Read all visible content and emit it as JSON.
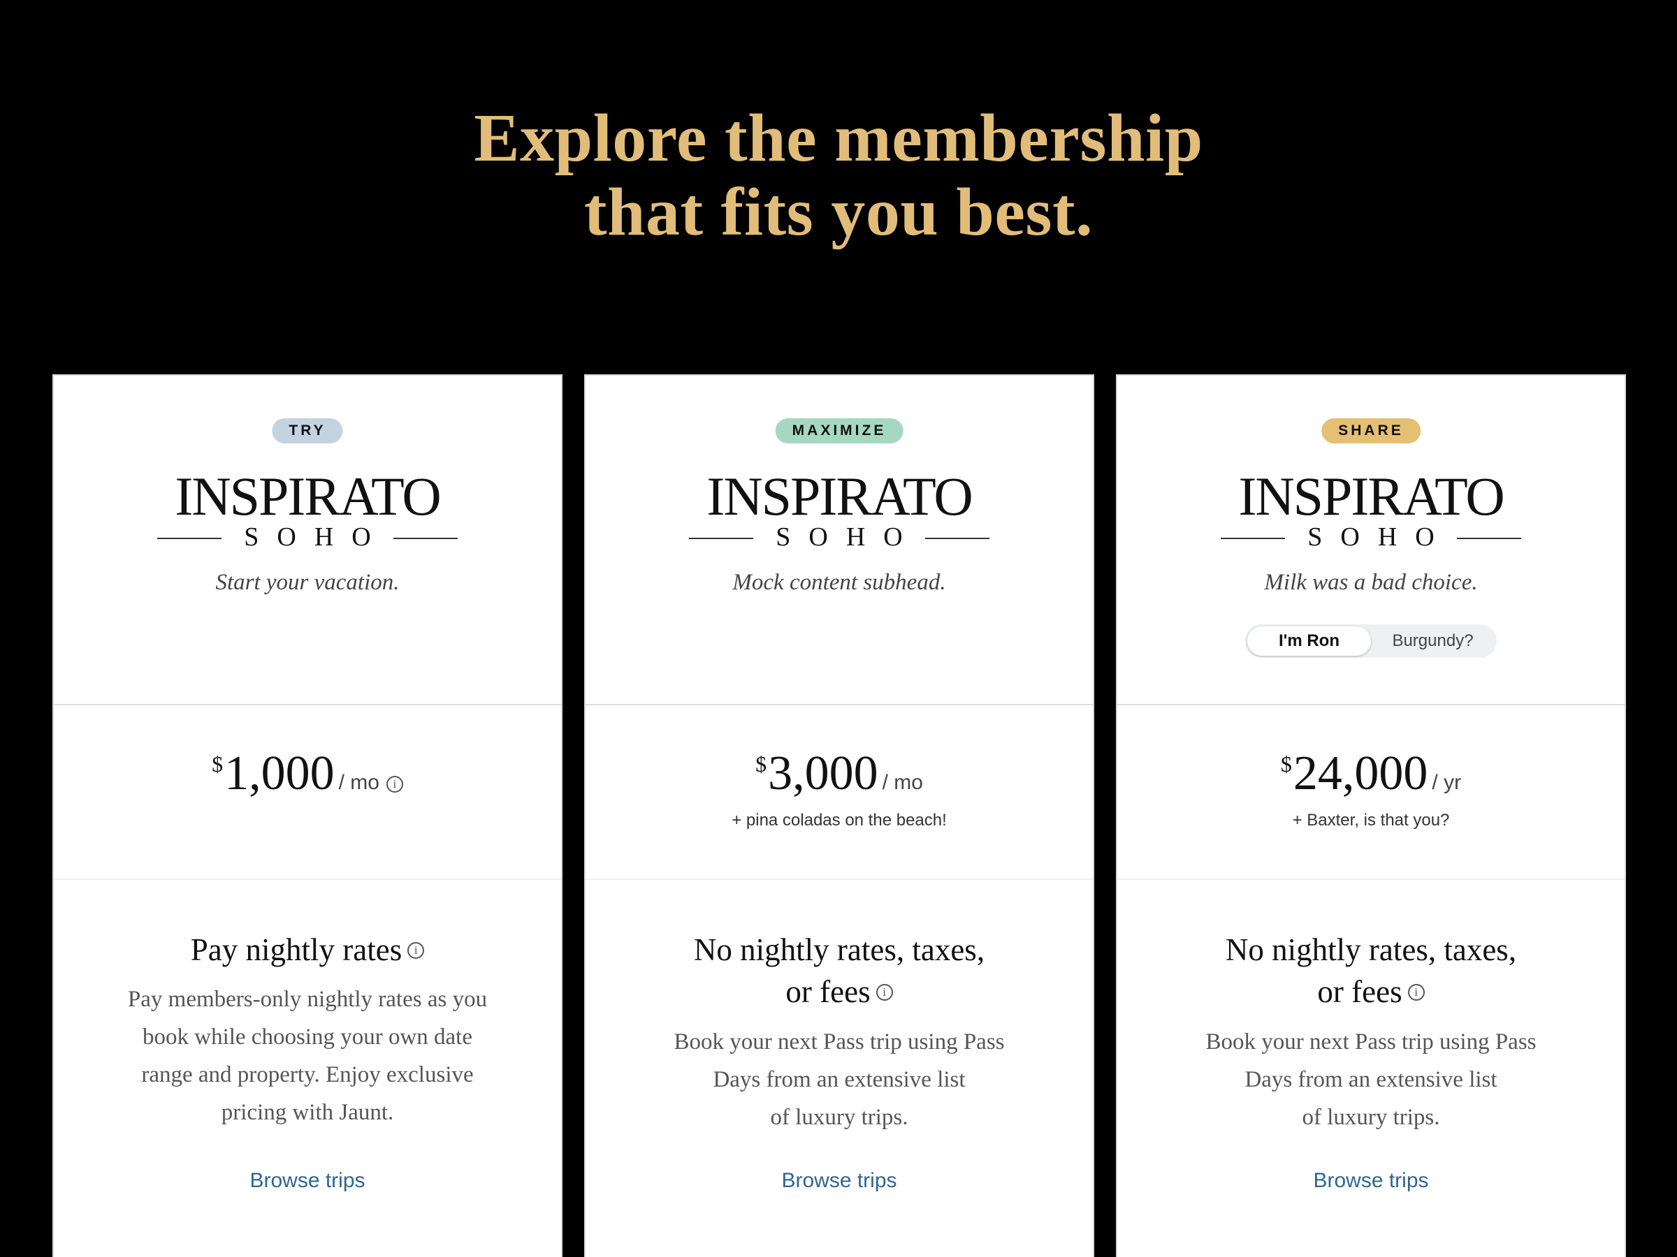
{
  "hero": {
    "line1": "Explore the membership",
    "line2": "that fits you best."
  },
  "colors": {
    "background": "#000000",
    "hero_text": "#e1bd79",
    "badge_try": "#c3d3df",
    "badge_maximize": "#a6d8c1",
    "badge_share": "#e4bf74",
    "link": "#2f6690"
  },
  "logo": {
    "wordmark": "INSPIRATO",
    "sub": "SOHO"
  },
  "cards": [
    {
      "badge": "TRY",
      "subhead": "Start your vacation.",
      "currency": "$",
      "amount": "1,000",
      "period": "/ mo",
      "price_note": "",
      "price_info_icon": "info-icon",
      "feature_title": [
        "Pay nightly rates"
      ],
      "feature_body": [
        "Pay members-only nightly rates as you",
        "book while choosing your own date",
        "range and property. Enjoy exclusive",
        "pricing with Jaunt."
      ],
      "link": "Browse trips"
    },
    {
      "badge": "MAXIMIZE",
      "subhead": "Mock content subhead.",
      "currency": "$",
      "amount": "3,000",
      "period": "/ mo",
      "price_note": "+ pina coladas on the beach!",
      "feature_title": [
        "No nightly rates, taxes,",
        "or fees"
      ],
      "feature_body": [
        "Book your next Pass trip using Pass",
        "Days from an extensive list",
        "of luxury trips."
      ],
      "link": "Browse trips"
    },
    {
      "badge": "SHARE",
      "subhead": "Milk was a bad choice.",
      "toggle": {
        "options": [
          "I'm Ron",
          "Burgundy?"
        ],
        "selected": "I'm Ron"
      },
      "currency": "$",
      "amount": "24,000",
      "period": "/ yr",
      "price_note": "+ Baxter, is that you?",
      "feature_title": [
        "No nightly rates, taxes,",
        "or fees"
      ],
      "feature_body": [
        "Book your next Pass trip using Pass",
        "Days from an extensive list",
        "of luxury trips."
      ],
      "link": "Browse trips"
    }
  ]
}
